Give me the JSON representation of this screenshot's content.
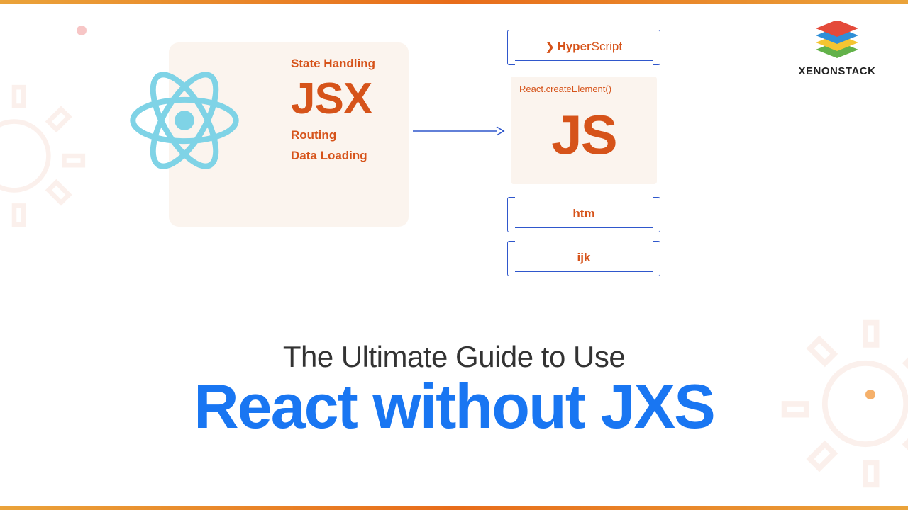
{
  "brand": {
    "name": "XENONSTACK"
  },
  "jsx_panel": {
    "top_label": "State Handling",
    "main": "JSX",
    "sub1": "Routing",
    "sub2": "Data Loading"
  },
  "right_column": {
    "hyperscript": {
      "bold": "Hyper",
      "thin": "Script"
    },
    "create_element": {
      "label": "React.createElement()",
      "main": "JS"
    },
    "htm": "htm",
    "ijk": "ijk"
  },
  "title": {
    "line1": "The Ultimate Guide to Use",
    "line2": "React without JXS"
  },
  "colors": {
    "accent_orange": "#d6531a",
    "accent_blue": "#1976f2",
    "border_blue": "#2f57cc",
    "panel_bg": "#fbf4ee",
    "react_cyan": "#7fd3e6"
  }
}
